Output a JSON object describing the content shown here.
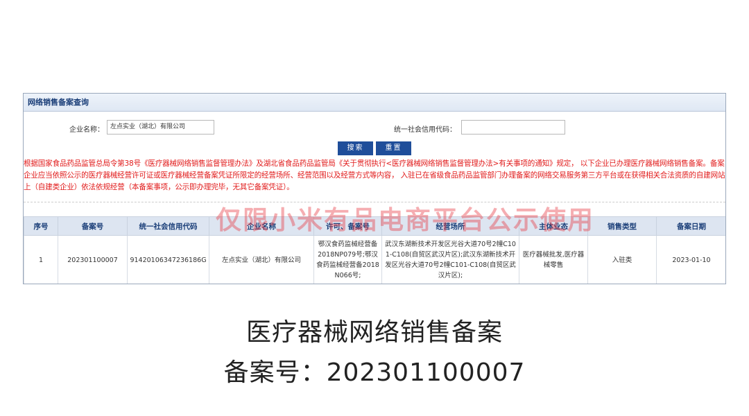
{
  "panel": {
    "title": "网络销售备案查询"
  },
  "form": {
    "company_label": "企业名称：",
    "company_value": "左点实业（湖北）有限公司",
    "credit_label": "统一社会信用代码：",
    "credit_value": "",
    "search_label": "搜索",
    "reset_label": "重置"
  },
  "notice": "根据国家食品药品监管总局令第38号《医疗器械网络销售监督管理办法》及湖北省食品药品监管局《关于贯彻执行<医疗器械网络销售监督管理办法>有关事项的通知》规定， 以下企业已办理医疗器械网络销售备案。备案企业应当依照公示的医疗器械经营许可证或医疗器械经营备案凭证所限定的经营场所、经营范围以及经营方式等内容， 入驻已在省级食品药品监管部门办理备案的网络交易服务第三方平台或在获得相关合法资质的自建网站上（自建类企业）依法依规经营（本备案事项，公示即办理完毕，无其它备案凭证）。",
  "watermark": "仅限小米有品电商平台公示使用",
  "table": {
    "headers": [
      "序号",
      "备案号",
      "统一社会信用代码",
      "企业名称",
      "许可、备案号",
      "经营场所",
      "主体业态",
      "销售类型",
      "备案日期"
    ],
    "rows": [
      [
        "1",
        "202301100007",
        "91420106347236186G",
        "左点实业（湖北）有限公司",
        "鄂汉食药监械经营备2018NP079号;鄂汉食药监械经营备2018N066号;",
        "武汉东湖新技术开发区光谷大道70号2幢C101-C108(自贸区武汉片区);武汉东湖新技术开发区光谷大道70号2幢C101-C108(自贸区武汉片区);",
        "医疗器械批发,医疗器械零售",
        "入驻类",
        "2023-01-10"
      ]
    ]
  },
  "caption": {
    "line1": "医疗器械网络销售备案",
    "line2": "备案号：202301100007"
  }
}
